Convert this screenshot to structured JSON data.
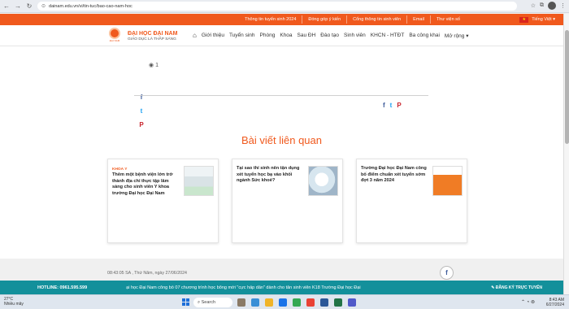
{
  "browser": {
    "url": "dainam.edu.vn/vi/tin-tuc/bao-cao-nam-hoc",
    "back_icon": "back-arrow-icon",
    "forward_icon": "forward-arrow-icon",
    "reload_icon": "reload-icon"
  },
  "topbar": {
    "items": [
      "Thông tin tuyển sinh 2024",
      "Đóng góp ý kiến",
      "Cổng thông tin sinh viên",
      "Email",
      "Thư viện số"
    ],
    "language": "Tiếng Việt",
    "brand_color": "#f0591d"
  },
  "header": {
    "brand": "ĐẠI HỌC ĐẠI NAM",
    "slogan": "GIÁO DỤC LÀ THẮP SÁNG",
    "logo_text": "ĐẠI NAM",
    "menu": [
      "Giới thiệu",
      "Tuyển sinh",
      "Phòng",
      "Khoa",
      "Sau ĐH",
      "Đào tạo",
      "Sinh viên",
      "KHCN - HTĐT",
      "Ba công khai",
      "Mở rộng"
    ]
  },
  "article": {
    "views": "1"
  },
  "related": {
    "title": "Bài viết liên quan",
    "cards": [
      {
        "tag": "KHOA Y",
        "title": "Thêm một bệnh viện lớn trở thành địa chỉ thực tập lâm sàng cho sinh viên Y khoa trường Đại học Đại Nam"
      },
      {
        "tag": "",
        "title": "Tại sao thí sinh nên tận dụng xét tuyển học bạ vào khối ngành Sức khoẻ?"
      },
      {
        "tag": "",
        "title": "Trường Đại học Đại Nam công bố điểm chuẩn xét tuyển sớm đợt 3 năm 2024"
      }
    ]
  },
  "footer": {
    "date": "08:43:05 SA , Thứ Năm, ngày 27/06/2024",
    "hotline": "HOTLINE: 0961.595.599",
    "ticker": "ại học Đại Nam công bố 07 chương trình học bổng mới \"cực hấp dẫn\" dành cho tân sinh viên K18       Trường Đại học Đại",
    "register": "ĐĂNG KÝ TRỰC TUYẾN",
    "accent": "#13909b"
  },
  "taskbar": {
    "weather_temp": "27°C",
    "weather_desc": "Nhiều mây",
    "search": "Search",
    "time": "8:43 AM",
    "date": "6/27/2024"
  }
}
